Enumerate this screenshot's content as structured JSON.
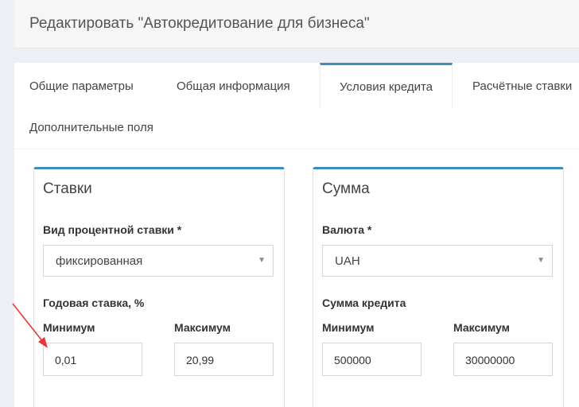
{
  "header": {
    "title": "Редактировать \"Автокредитование для бизнеса\""
  },
  "tabs": [
    {
      "label": "Общие параметры"
    },
    {
      "label": "Общая информация"
    },
    {
      "label": "Условия кредита"
    },
    {
      "label": "Расчётные ставки"
    },
    {
      "label": "Дополнительные поля"
    }
  ],
  "active_tab": "Условия кредита",
  "rates_box": {
    "title": "Ставки",
    "rate_type_label": "Вид процентной ставки *",
    "rate_type_value": "фиксированная",
    "annual_rate_label": "Годовая ставка, %",
    "min_label": "Минимум",
    "max_label": "Максимум",
    "min_value": "0,01",
    "max_value": "20,99"
  },
  "sum_box": {
    "title": "Сумма",
    "currency_label": "Валюта *",
    "currency_value": "UAH",
    "amount_label": "Сумма кредита",
    "min_label": "Минимум",
    "max_label": "Максимум",
    "min_value": "500000",
    "max_value": "30000000"
  },
  "colors": {
    "accent": "#3c8dbc",
    "annotation_arrow": "#e53935"
  }
}
